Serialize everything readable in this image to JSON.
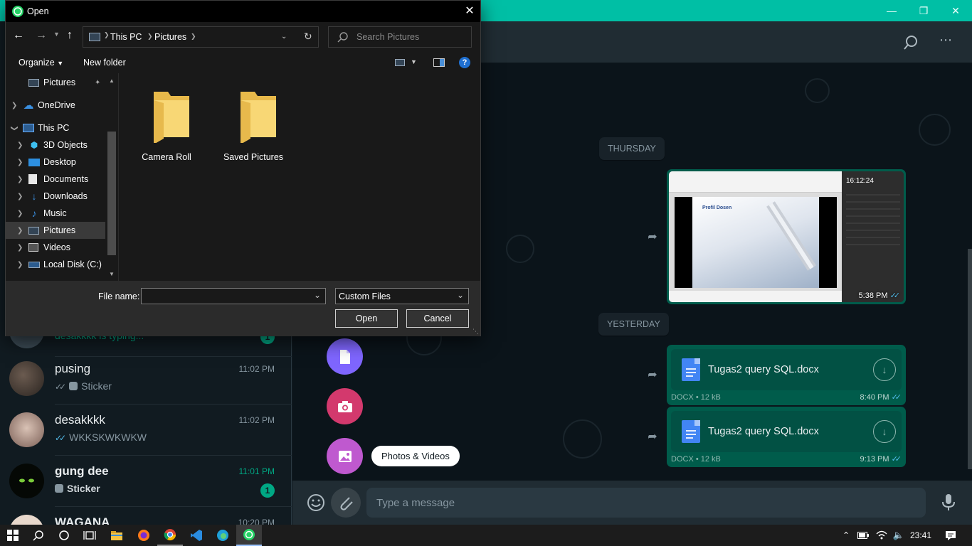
{
  "dialog": {
    "title": "Open",
    "breadcrumb": [
      "This PC",
      "Pictures"
    ],
    "search_placeholder": "Search Pictures",
    "toolbar": {
      "organize": "Organize",
      "new_folder": "New folder"
    },
    "nav_items": [
      {
        "label": "Pictures",
        "icon": "pictures-icon",
        "expand": false,
        "pinned": true
      },
      {
        "label": "OneDrive",
        "icon": "cloud-icon",
        "expand": "collapsed"
      },
      {
        "label": "This PC",
        "icon": "computer-icon",
        "expand": "expanded"
      },
      {
        "label": "3D Objects",
        "icon": "cube-icon",
        "expand": "collapsed"
      },
      {
        "label": "Desktop",
        "icon": "desktop-icon",
        "expand": "collapsed"
      },
      {
        "label": "Documents",
        "icon": "documents-icon",
        "expand": "collapsed"
      },
      {
        "label": "Downloads",
        "icon": "download-icon",
        "expand": "collapsed"
      },
      {
        "label": "Music",
        "icon": "music-icon",
        "expand": "collapsed"
      },
      {
        "label": "Pictures",
        "icon": "pictures-icon",
        "expand": "collapsed",
        "selected": true
      },
      {
        "label": "Videos",
        "icon": "videos-icon",
        "expand": "collapsed"
      },
      {
        "label": "Local Disk (C:)",
        "icon": "disk-icon",
        "expand": "collapsed"
      }
    ],
    "folders": [
      "Camera Roll",
      "Saved Pictures"
    ],
    "file_name_label": "File name:",
    "file_name_value": "",
    "file_type": "Custom Files",
    "open_button": "Open",
    "cancel_button": "Cancel"
  },
  "chats": [
    {
      "name": "",
      "last": "desakkkk is typing...",
      "time": "",
      "unread": "1"
    },
    {
      "name": "pusing",
      "last": "Sticker",
      "time": "11:02 PM",
      "tick": "grey",
      "sticker": true
    },
    {
      "name": "desakkkk",
      "last": "WKKSKWKWKW",
      "time": "11:02 PM",
      "tick": "blue"
    },
    {
      "name": "gung dee",
      "last": "Sticker",
      "time": "11:01 PM",
      "unread": "1",
      "sticker": true
    },
    {
      "name": "WAGANA",
      "last": "",
      "time": "10:20 PM"
    }
  ],
  "conversation": {
    "date_thursday": "THURSDAY",
    "date_yesterday": "YESTERDAY",
    "image_message": {
      "time": "5:38 PM",
      "clock": "16:12:24",
      "slide_title": "Profil Dosen"
    },
    "documents": [
      {
        "name": "Tugas2 query SQL.docx",
        "meta": "DOCX • 12 kB",
        "time": "8:40 PM"
      },
      {
        "name": "Tugas2 query SQL.docx",
        "meta": "DOCX • 12 kB",
        "time": "9:13 PM"
      }
    ],
    "attach_tooltip": "Photos & Videos",
    "input_placeholder": "Type a message"
  },
  "taskbar": {
    "time": "23:41"
  },
  "colors": {
    "whatsapp_accent": "#00bfa5",
    "outgoing_bubble": "#005c4b",
    "document_icon": "#4285f4",
    "attach_document": "#7f66ff",
    "attach_camera": "#d3396d",
    "attach_photos": "#bf59cf",
    "unread_badge": "#00a884",
    "read_tick": "#53bdeb"
  }
}
